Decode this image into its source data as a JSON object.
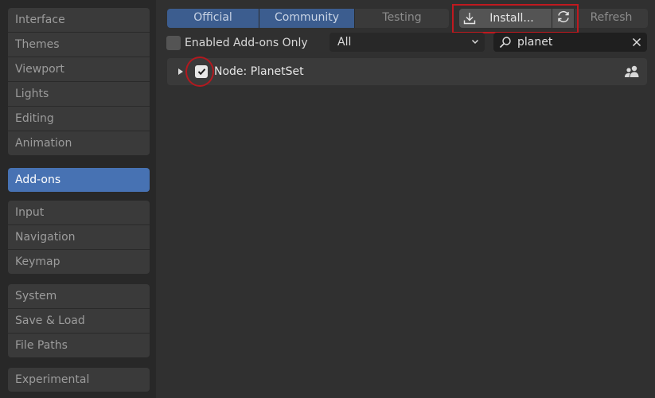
{
  "sidebar": {
    "groups": [
      {
        "items": [
          {
            "label": "Interface"
          },
          {
            "label": "Themes"
          },
          {
            "label": "Viewport"
          },
          {
            "label": "Lights"
          },
          {
            "label": "Editing"
          },
          {
            "label": "Animation"
          }
        ]
      },
      {
        "items": [
          {
            "label": "Add-ons",
            "active": true
          }
        ]
      },
      {
        "items": [
          {
            "label": "Input"
          },
          {
            "label": "Navigation"
          },
          {
            "label": "Keymap"
          }
        ]
      },
      {
        "items": [
          {
            "label": "System"
          },
          {
            "label": "Save & Load"
          },
          {
            "label": "File Paths"
          }
        ]
      },
      {
        "items": [
          {
            "label": "Experimental"
          }
        ]
      }
    ]
  },
  "tabs": {
    "official": "Official",
    "community": "Community",
    "testing": "Testing"
  },
  "actions": {
    "install_label": "Install...",
    "refresh_label": "Refresh",
    "install_icon": "download-icon",
    "refresh_icon": "refresh-icon"
  },
  "filters": {
    "enabled_only_label": "Enabled Add-ons Only",
    "enabled_only_checked": false,
    "category_value": "All",
    "search_value": "planet"
  },
  "addons": [
    {
      "name": "Node: PlanetSet",
      "enabled": true,
      "expanded": false,
      "icon": "users-icon"
    }
  ],
  "colors": {
    "accent": "#4772b3",
    "highlight": "#c0191f",
    "background": "#303030"
  }
}
